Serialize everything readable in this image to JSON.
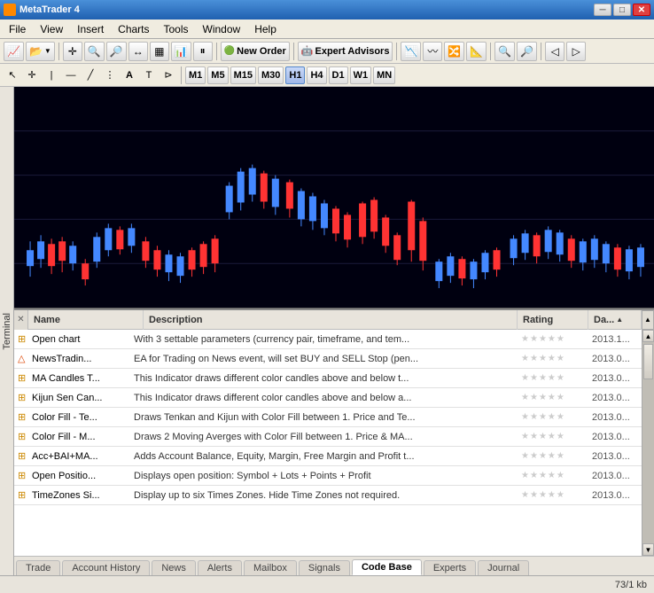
{
  "titleBar": {
    "title": "MetaTrader 4",
    "minBtn": "─",
    "maxBtn": "□",
    "closeBtn": "✕"
  },
  "menuBar": {
    "items": [
      "File",
      "View",
      "Insert",
      "Charts",
      "Tools",
      "Window",
      "Help"
    ]
  },
  "toolbar1": {
    "newOrder": "New Order",
    "expertAdvisors": "Expert Advisors"
  },
  "toolbar2": {
    "timeframes": [
      "M1",
      "M5",
      "M15",
      "M30",
      "H1",
      "H4",
      "D1",
      "W1",
      "MN"
    ],
    "activeTimeframe": "H1"
  },
  "table": {
    "headers": {
      "name": "Name",
      "description": "Description",
      "rating": "Rating",
      "date": "Da..."
    },
    "rows": [
      {
        "icon": "⊞",
        "iconColor": "yellow",
        "name": "Open chart",
        "description": "With 3 settable parameters (currency pair, timeframe, and tem...",
        "rating": [
          0,
          0,
          0,
          0,
          0
        ],
        "date": "2013.1..."
      },
      {
        "icon": "△",
        "iconColor": "orange",
        "name": "NewsTradin...",
        "description": "EA for Trading on News event, will set BUY and SELL Stop (pen...",
        "rating": [
          0,
          0,
          0,
          0,
          0
        ],
        "date": "2013.0..."
      },
      {
        "icon": "⊞",
        "iconColor": "yellow",
        "name": "MA Candles T...",
        "description": "This Indicator draws different color candles above and below t...",
        "rating": [
          0,
          0,
          0,
          0,
          0
        ],
        "date": "2013.0..."
      },
      {
        "icon": "⊞",
        "iconColor": "yellow",
        "name": "Kijun Sen Can...",
        "description": "This Indicator draws different color candles above and below a...",
        "rating": [
          0,
          0,
          0,
          0,
          0
        ],
        "date": "2013.0..."
      },
      {
        "icon": "⊞",
        "iconColor": "yellow",
        "name": "Color Fill - Te...",
        "description": "Draws Tenkan and Kijun with Color Fill between 1. Price and Te...",
        "rating": [
          0,
          0,
          0,
          0,
          0
        ],
        "date": "2013.0..."
      },
      {
        "icon": "⊞",
        "iconColor": "yellow",
        "name": "Color Fill - M...",
        "description": "Draws 2 Moving Averges with Color Fill between 1. Price & MA...",
        "rating": [
          0,
          0,
          0,
          0,
          0
        ],
        "date": "2013.0..."
      },
      {
        "icon": "⊞",
        "iconColor": "yellow",
        "name": "Acc+BAI+MA...",
        "description": "Adds Account Balance, Equity, Margin, Free Margin and Profit t...",
        "rating": [
          0,
          0,
          0,
          0,
          0
        ],
        "date": "2013.0..."
      },
      {
        "icon": "⊞",
        "iconColor": "yellow",
        "name": "Open Positio...",
        "description": "Displays open position: Symbol + Lots + Points + Profit",
        "rating": [
          0,
          0,
          0,
          0,
          0
        ],
        "date": "2013.0..."
      },
      {
        "icon": "⊞",
        "iconColor": "yellow",
        "name": "TimeZones Si...",
        "description": "Display up to six Times Zones. Hide Time Zones not required.",
        "rating": [
          0,
          0,
          0,
          0,
          0
        ],
        "date": "2013.0..."
      }
    ]
  },
  "bottomTabs": {
    "items": [
      "Trade",
      "Account History",
      "News",
      "Alerts",
      "Mailbox",
      "Signals",
      "Code Base",
      "Experts",
      "Journal"
    ],
    "active": "Code Base"
  },
  "statusBar": {
    "text": "73/1 kb"
  },
  "terminal": {
    "label": "Terminal"
  }
}
